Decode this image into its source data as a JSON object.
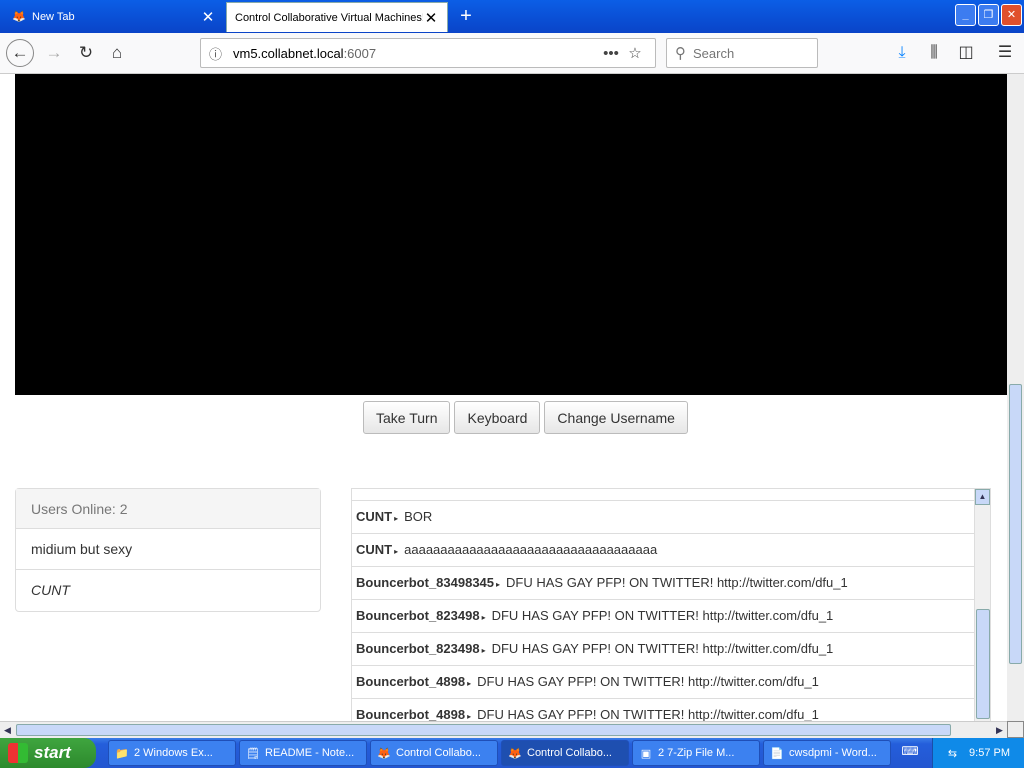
{
  "browser": {
    "tabs": [
      {
        "title": "New Tab",
        "active": false
      },
      {
        "title": "Control Collaborative Virtual Machines!",
        "active": true
      }
    ],
    "url_host": "vm5.collabnet.local",
    "url_port": ":6007",
    "search_placeholder": "Search"
  },
  "vm": {
    "buttons": {
      "take_turn": "Take Turn",
      "keyboard": "Keyboard",
      "change_username": "Change Username"
    }
  },
  "users": {
    "header": "Users Online: 2",
    "list": [
      "midium but sexy",
      "CUNT"
    ]
  },
  "chat": {
    "messages": [
      {
        "user": "CUNT",
        "text": "BOR"
      },
      {
        "user": "CUNT",
        "text": "aaaaaaaaaaaaaaaaaaaaaaaaaaaaaaaaaaa"
      },
      {
        "user": "Bouncerbot_83498345",
        "text": "DFU HAS GAY PFP! ON TWITTER! http://twitter.com/dfu_1"
      },
      {
        "user": "Bouncerbot_823498",
        "text": "DFU HAS GAY PFP! ON TWITTER! http://twitter.com/dfu_1"
      },
      {
        "user": "Bouncerbot_823498",
        "text": "DFU HAS GAY PFP! ON TWITTER! http://twitter.com/dfu_1"
      },
      {
        "user": "Bouncerbot_4898",
        "text": "DFU HAS GAY PFP! ON TWITTER! http://twitter.com/dfu_1"
      },
      {
        "user": "Bouncerbot_4898",
        "text": "DFU HAS GAY PFP! ON TWITTER! http://twitter.com/dfu_1"
      }
    ]
  },
  "taskbar": {
    "start_label": "start",
    "tasks": [
      {
        "label": "2 Windows Ex...",
        "icon": "folder-icon"
      },
      {
        "label": "README - Note...",
        "icon": "notepad-icon"
      },
      {
        "label": "Control Collabo...",
        "icon": "firefox-icon"
      },
      {
        "label": "Control Collabo...",
        "icon": "firefox-icon"
      },
      {
        "label": "2 7-Zip File M...",
        "icon": "zip-icon"
      },
      {
        "label": "cwsdpmi - Word...",
        "icon": "wordpad-icon"
      }
    ],
    "clock": "9:57 PM"
  },
  "colors": {
    "accent": "#245edb",
    "vm_screen": "#000000"
  }
}
